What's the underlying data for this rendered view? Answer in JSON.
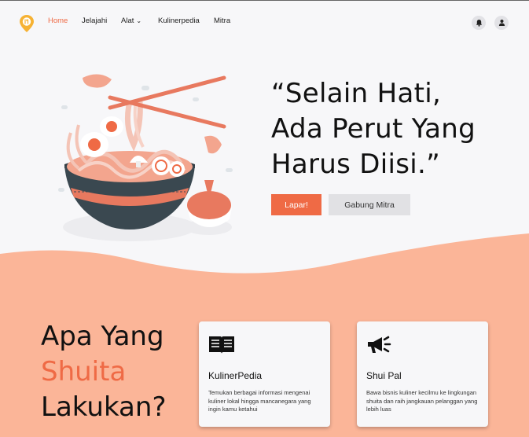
{
  "nav": {
    "links": [
      "Home",
      "Jelajahi",
      "Alat",
      "Kulinerpedia",
      "Mitra"
    ],
    "active": "Home"
  },
  "hero": {
    "headline_lines": [
      "“Selain Hati,",
      "Ada Perut Yang",
      "Harus Diisi.”"
    ],
    "primary_button": "Lapar!",
    "secondary_button": "Gabung Mitra"
  },
  "section": {
    "title_line1": "Apa Yang",
    "title_line2": "Shuita",
    "title_line3": "Lakukan?"
  },
  "cards": [
    {
      "icon": "book-open-icon",
      "title": "KulinerPedia",
      "desc": "Temukan berbagai informasi mengenai kuliner lokal hingga mancanegara yang ingin kamu ketahui"
    },
    {
      "icon": "megaphone-icon",
      "title": "Shui Pal",
      "desc": "Bawa bisnis kuliner kecilmu ke lingkungan shuita dan raih jangkauan pelanggan yang lebih luas"
    }
  ],
  "colors": {
    "accent": "#ef6a45",
    "wave": "#fbb598",
    "background": "#f7f7f9"
  }
}
